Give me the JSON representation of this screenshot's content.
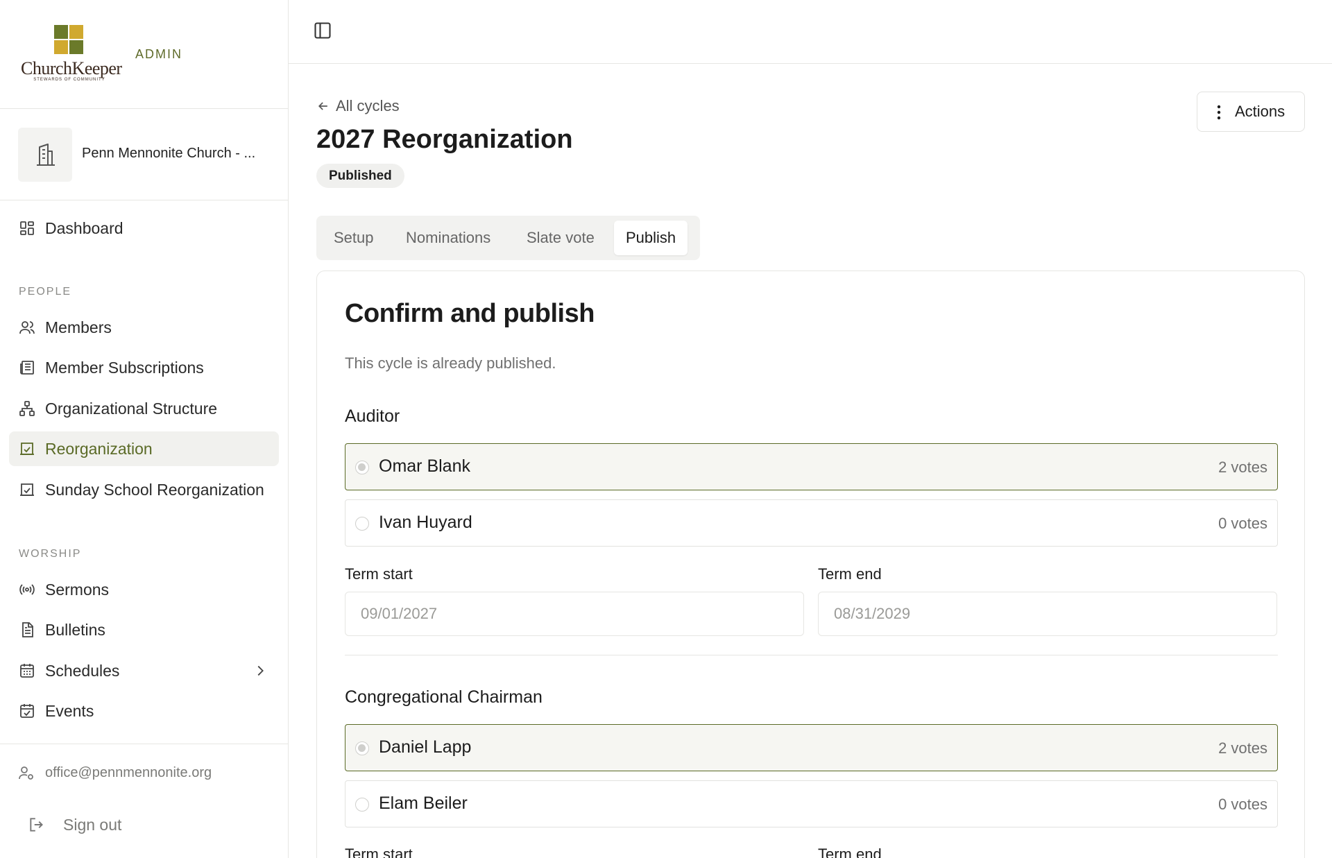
{
  "brand": {
    "logo_text": "ChurchKeeper",
    "logo_tagline": "STEWARDS OF COMMUNITY",
    "admin_label": "ADMIN",
    "colors": {
      "square_tl": "#6b7a2a",
      "square_tr": "#d0a92f",
      "square_bl": "#d0a92f",
      "square_br": "#6b7a2a",
      "accent": "#5a6a26"
    }
  },
  "church": {
    "name": "Penn Mennonite Church - ...",
    "icon": "building-icon"
  },
  "sidebar": {
    "dashboard": {
      "label": "Dashboard",
      "icon": "dashboard-icon"
    },
    "sections": [
      {
        "title": "PEOPLE"
      },
      {
        "title": "WORSHIP"
      }
    ],
    "people_items": [
      {
        "label": "Members",
        "icon": "users-icon"
      },
      {
        "label": "Member Subscriptions",
        "icon": "newspaper-icon"
      },
      {
        "label": "Organizational Structure",
        "icon": "org-chart-icon"
      },
      {
        "label": "Reorganization",
        "icon": "calendar-check-icon",
        "active": true
      },
      {
        "label": "Sunday School Reorganization",
        "icon": "calendar-check-icon"
      }
    ],
    "worship_items": [
      {
        "label": "Sermons",
        "icon": "broadcast-icon"
      },
      {
        "label": "Bulletins",
        "icon": "document-icon"
      },
      {
        "label": "Schedules",
        "icon": "calendar-grid-icon",
        "has_submenu": true
      },
      {
        "label": "Events",
        "icon": "calendar-check-icon"
      }
    ],
    "footer": {
      "email": "office@pennmennonite.org",
      "signout": "Sign out"
    }
  },
  "page": {
    "back_link": "All cycles",
    "title": "2027 Reorganization",
    "status": "Published",
    "actions_label": "Actions",
    "tabs": [
      {
        "label": "Setup"
      },
      {
        "label": "Nominations"
      },
      {
        "label": "Slate vote"
      },
      {
        "label": "Publish",
        "active": true
      }
    ]
  },
  "card": {
    "title": "Confirm and publish",
    "description": "This cycle is already published.",
    "offices": [
      {
        "name": "Auditor",
        "candidates": [
          {
            "name": "Omar Blank",
            "votes": "2 votes",
            "selected": true
          },
          {
            "name": "Ivan Huyard",
            "votes": "0 votes",
            "selected": false
          }
        ],
        "term_start_label": "Term start",
        "term_start_value": "09/01/2027",
        "term_end_label": "Term end",
        "term_end_value": "08/31/2029"
      },
      {
        "name": "Congregational Chairman",
        "candidates": [
          {
            "name": "Daniel Lapp",
            "votes": "2 votes",
            "selected": true
          },
          {
            "name": "Elam Beiler",
            "votes": "0 votes",
            "selected": false
          }
        ],
        "term_start_label": "Term start",
        "term_end_label": "Term end"
      }
    ]
  }
}
